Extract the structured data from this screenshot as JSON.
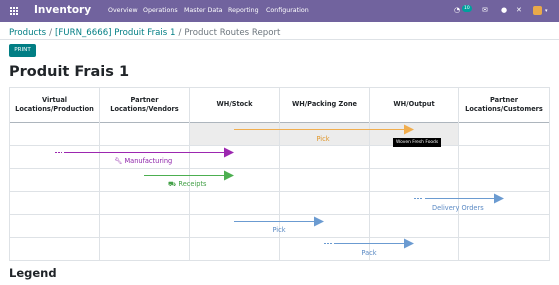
{
  "topbar": {
    "app_title": "Inventory",
    "menu": [
      "Overview",
      "Operations",
      "Master Data",
      "Reporting",
      "Configuration"
    ],
    "badge_count": "10"
  },
  "breadcrumb": {
    "products": "Products",
    "product": "[FURN_6666] Produit Frais 1",
    "current": "Product Routes Report"
  },
  "actions": {
    "print_label": "PRINT"
  },
  "page_title": "Produit Frais 1",
  "columns": [
    "Virtual Locations/Production",
    "Partner Locations/Vendors",
    "WH/Stock",
    "WH/Packing Zone",
    "WH/Output",
    "Partner Locations/Customers"
  ],
  "routes": {
    "pick_top": "Pick",
    "manufacturing": "Manufacturing",
    "receipts": "Receipts",
    "delivery_orders": "Delivery Orders",
    "pick": "Pick",
    "pack": "Pack"
  },
  "tooltip": "Woven Fresh Foods",
  "legend_title": "Legend",
  "colors": {
    "topbar": "#71639e",
    "brand_teal": "#017e84",
    "pick_orange": "#f0ad4e",
    "manufacturing_purple": "#9c27b0",
    "receipts_green": "#4caf50",
    "delivery_blue": "#6b9bd1"
  },
  "icons": [
    "apps-grid-icon",
    "wrench-icon",
    "truck-icon",
    "chat-icon",
    "activity-icon",
    "close-icon",
    "bug-icon"
  ]
}
